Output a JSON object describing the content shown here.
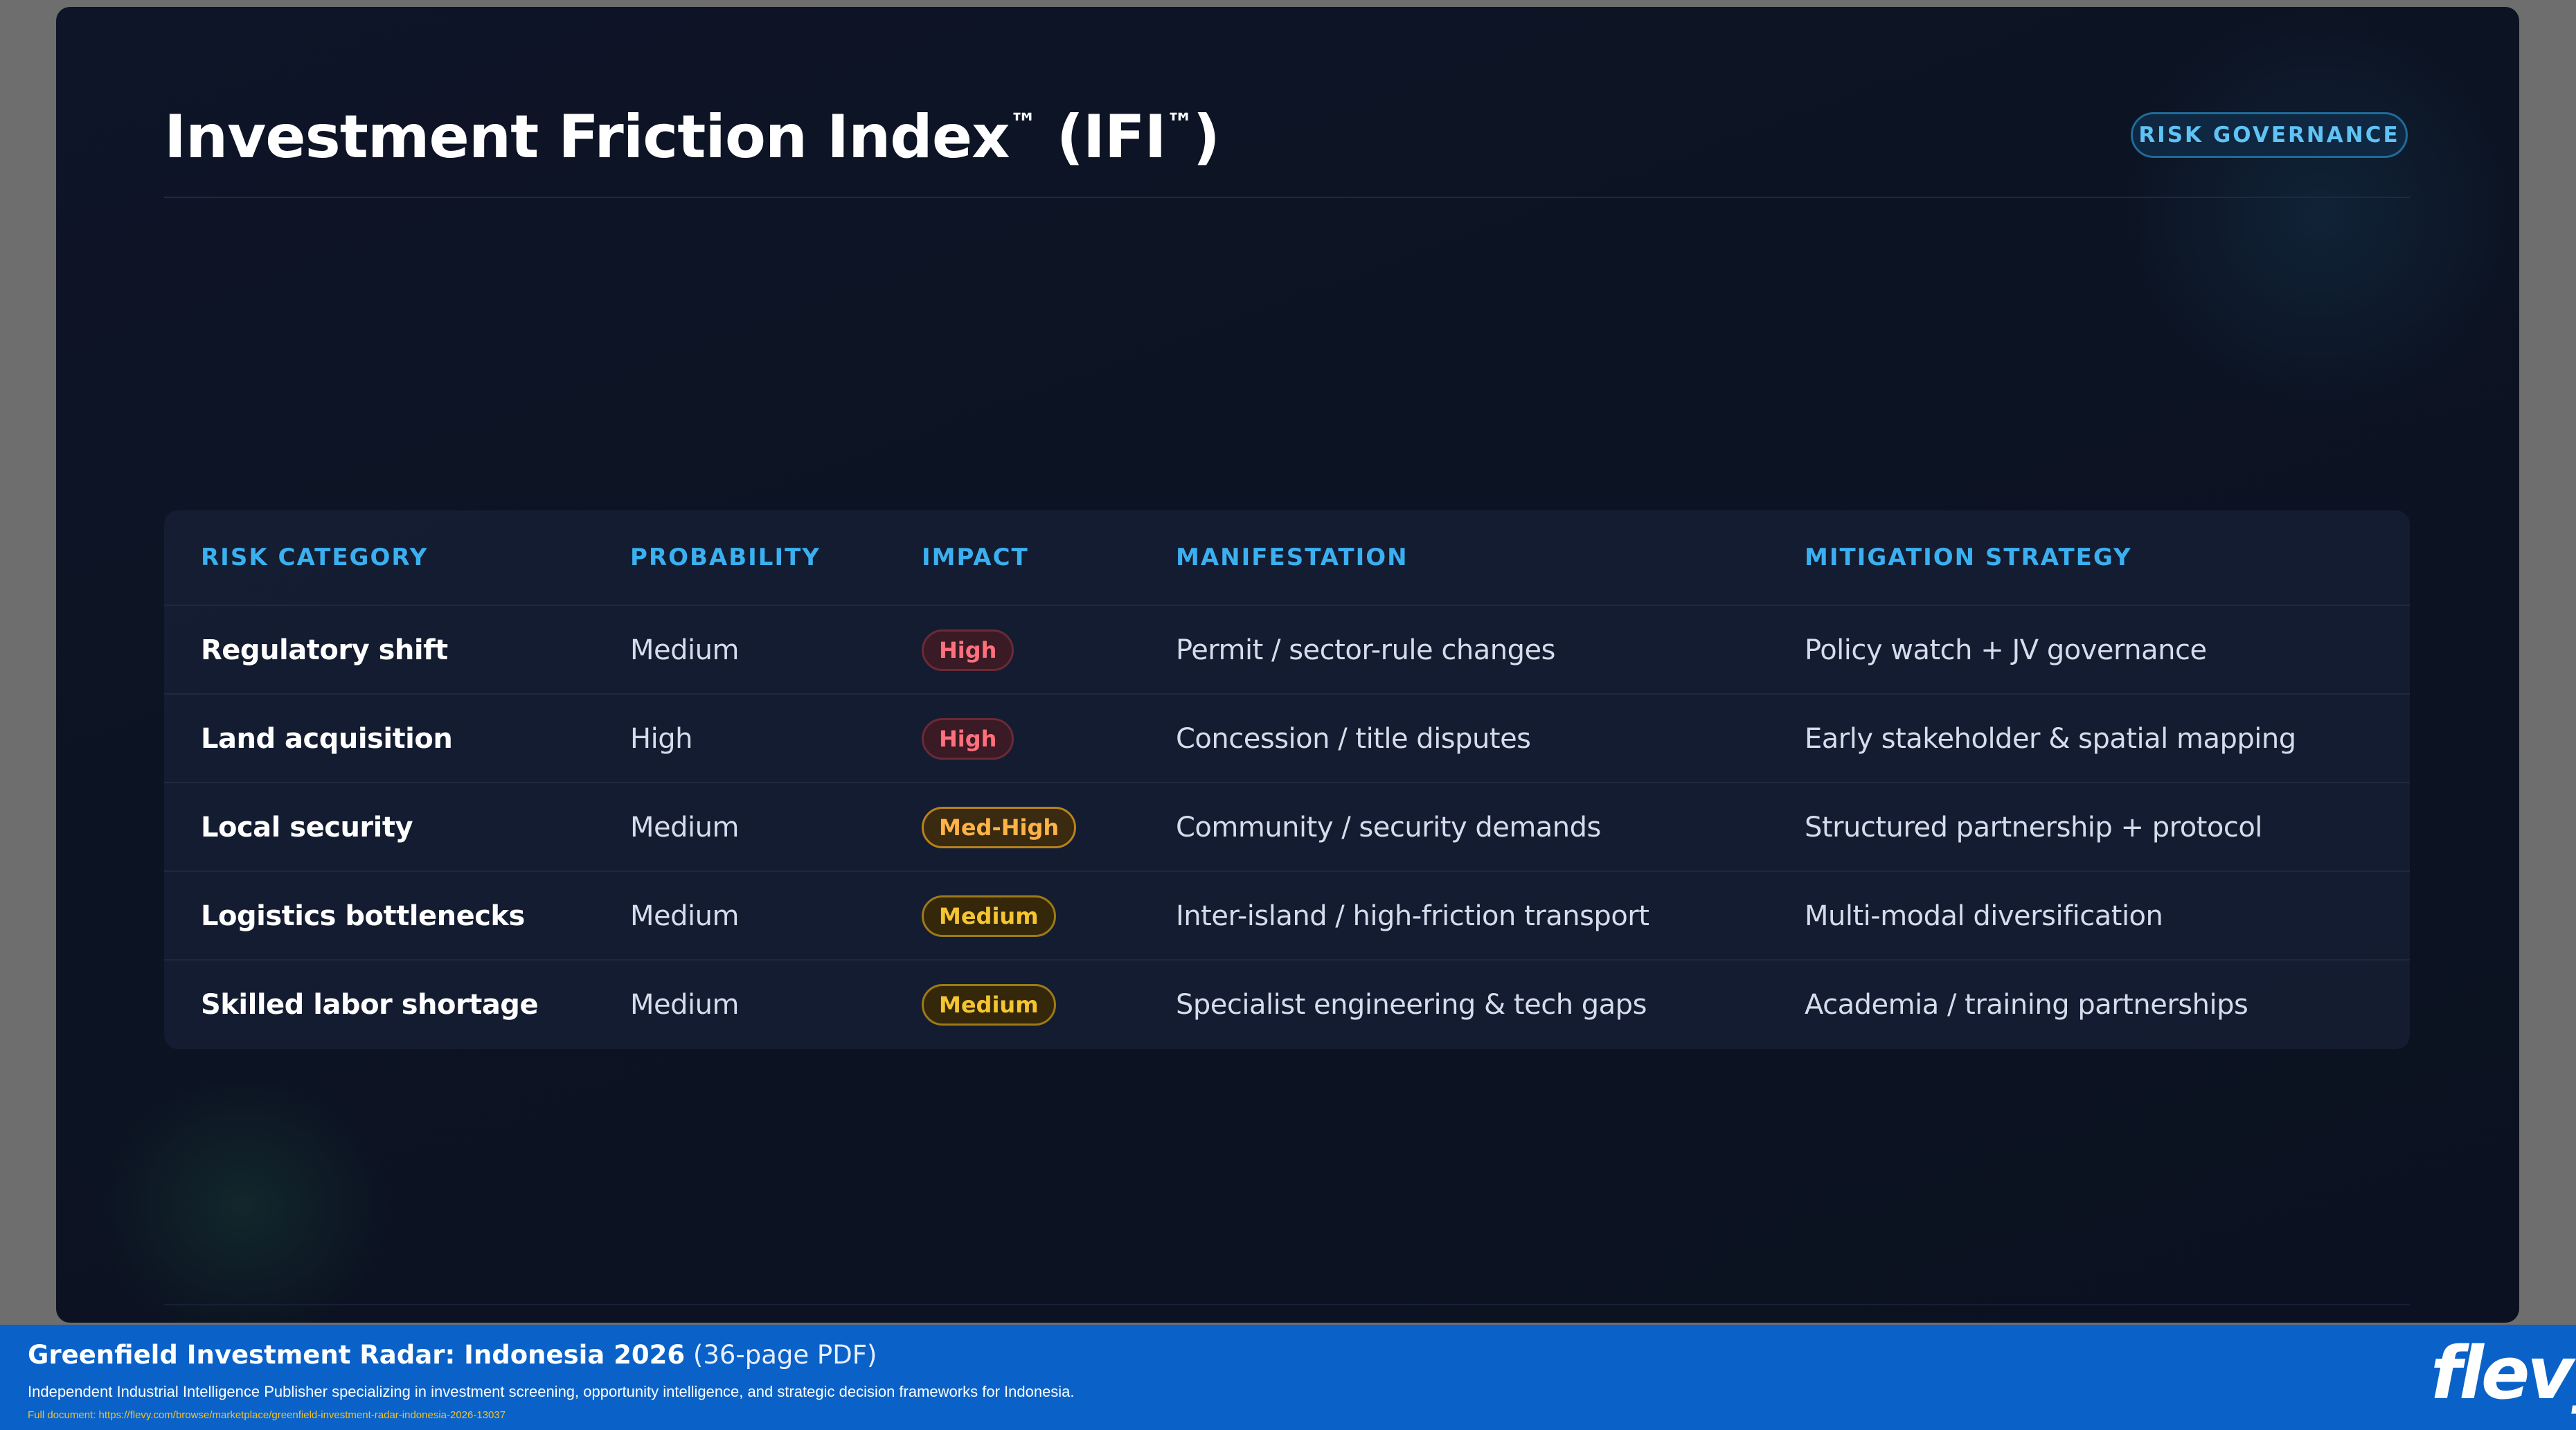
{
  "slide": {
    "title_main": "Investment Friction Index",
    "title_tm": "™",
    "title_paren_open": "(IFI",
    "title_paren_close": ")",
    "badge": "RISK GOVERNANCE"
  },
  "table": {
    "headers": [
      "RISK CATEGORY",
      "PROBABILITY",
      "IMPACT",
      "MANIFESTATION",
      "MITIGATION STRATEGY"
    ],
    "rows": [
      {
        "category": "Regulatory shift",
        "probability": "Medium",
        "impact": "High",
        "impact_level": "high",
        "manifestation": "Permit / sector-rule changes",
        "mitigation": "Policy watch + JV governance"
      },
      {
        "category": "Land acquisition",
        "probability": "High",
        "impact": "High",
        "impact_level": "high",
        "manifestation": "Concession / title disputes",
        "mitigation": "Early stakeholder & spatial mapping"
      },
      {
        "category": "Local security",
        "probability": "Medium",
        "impact": "Med-High",
        "impact_level": "medhigh",
        "manifestation": "Community / security demands",
        "mitigation": "Structured partnership + protocol"
      },
      {
        "category": "Logistics bottlenecks",
        "probability": "Medium",
        "impact": "Medium",
        "impact_level": "medium",
        "manifestation": "Inter-island / high-friction transport",
        "mitigation": "Multi-modal diversification"
      },
      {
        "category": "Skilled labor shortage",
        "probability": "Medium",
        "impact": "Medium",
        "impact_level": "medium",
        "manifestation": "Specialist engineering & tech gaps",
        "mitigation": "Academia / training partnerships"
      }
    ]
  },
  "colors": {
    "accent": "#3bb0f0",
    "high": "#ff6f7c",
    "medhigh": "#ffb347",
    "medium": "#f5c531",
    "footer": "#0a62c8"
  },
  "footer": {
    "title": "Greenfield Investment Radar: Indonesia 2026",
    "pages": "(36-page PDF)",
    "description": "Independent Industrial Intelligence Publisher specializing in investment screening, opportunity intelligence, and strategic decision frameworks for Indonesia.",
    "link": "Full document: https://flevy.com/browse/marketplace/greenfield-investment-radar-indonesia-2026-13037",
    "logo": "flevy"
  }
}
